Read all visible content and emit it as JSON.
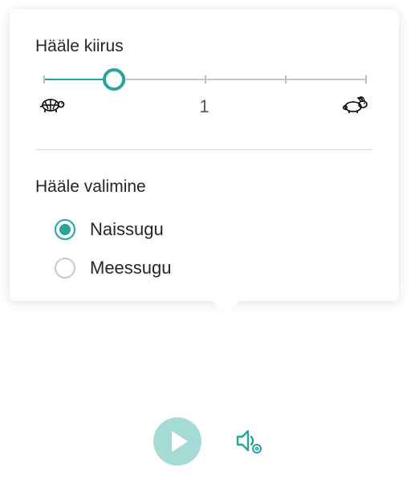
{
  "speed": {
    "title": "Hääle kiirus",
    "value_label": "1",
    "thumb_percent": 22
  },
  "voice": {
    "title": "Hääle valimine",
    "options": [
      {
        "label": "Naissugu",
        "selected": true
      },
      {
        "label": "Meessugu",
        "selected": false
      }
    ]
  },
  "icons": {
    "turtle": "turtle-icon",
    "rabbit": "rabbit-icon",
    "play": "play-icon",
    "settings": "voice-settings-icon"
  },
  "colors": {
    "accent": "#26a69a",
    "accent_light": "#a5dbd5"
  }
}
